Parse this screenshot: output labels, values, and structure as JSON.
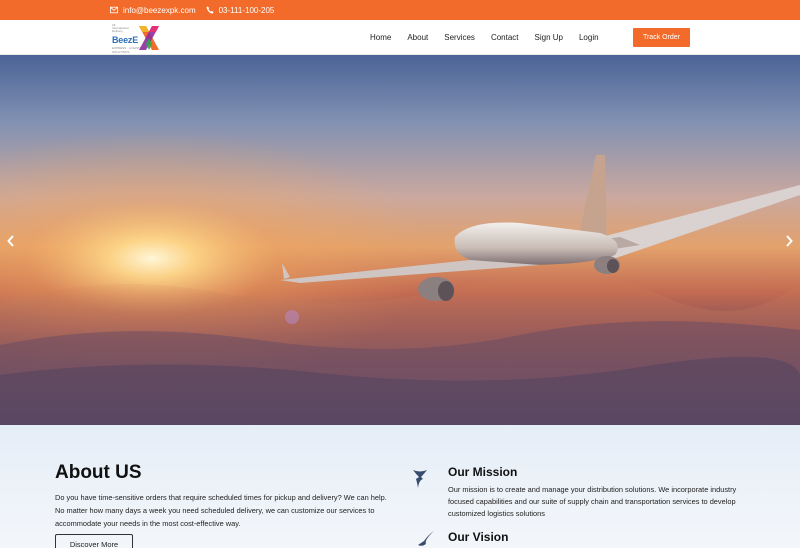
{
  "topbar": {
    "email": "info@beezexpk.com",
    "phone": "03-111-100-205",
    "icons": [
      "envelope-icon",
      "phone-icon"
    ],
    "color": "#f26b2a"
  },
  "logo": {
    "tagline": "All International Delivery",
    "brand": "BeezE",
    "brand_x": "X",
    "sub": "EXPRESS · LOGISTICS · SOLUTIONS"
  },
  "nav": {
    "items": [
      "Home",
      "About",
      "Services",
      "Contact",
      "Sign Up",
      "Login"
    ],
    "cta": "Track Order"
  },
  "hero": {
    "prev_icon": "chevron-left-icon",
    "next_icon": "chevron-right-icon"
  },
  "about": {
    "title": "About US",
    "description": "Do you have time-sensitive orders that require scheduled times for pickup and delivery? We can help. No matter how many days a week you need scheduled delivery, we can customize our services to accommodate your needs in the most cost-effective way.",
    "button": "Discover More",
    "mission": {
      "title": "Our Mission",
      "text": "Our mission is to create and manage your distribution solutions. We incorporate industry focused capabilities and our suite of supply chain and transportation services to develop customized logistics solutions"
    },
    "vision": {
      "title": "Our Vision"
    }
  }
}
